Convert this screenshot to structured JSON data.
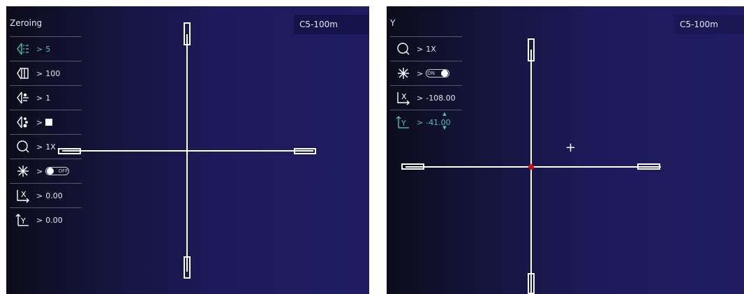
{
  "left": {
    "title": "Zeroing",
    "tag": "C5-100m",
    "menu": [
      {
        "icon": "zeroing-profile-icon",
        "arrow": ">",
        "value": "5"
      },
      {
        "icon": "zeroing-distance-icon",
        "arrow": ">",
        "value": "100"
      },
      {
        "icon": "reticle-type-icon",
        "arrow": ">",
        "value": "1"
      },
      {
        "icon": "reticle-color-icon",
        "arrow": ">",
        "value": ""
      },
      {
        "icon": "zoom-icon",
        "arrow": ">",
        "value": "1X"
      },
      {
        "icon": "freeze-icon",
        "arrow": ">",
        "value": "OFF"
      },
      {
        "icon": "x-axis-icon",
        "arrow": ">",
        "value": "0.00",
        "label": "X"
      },
      {
        "icon": "y-axis-icon",
        "arrow": ">",
        "value": "0.00",
        "label": "Y"
      }
    ]
  },
  "right": {
    "title": "Y",
    "tag": "C5-100m",
    "menu": [
      {
        "icon": "zoom-icon",
        "arrow": ">",
        "value": "1X"
      },
      {
        "icon": "freeze-icon",
        "arrow": ">",
        "value": "ON"
      },
      {
        "icon": "x-axis-icon",
        "arrow": ">",
        "value": "-108.00",
        "label": "X"
      },
      {
        "icon": "y-axis-icon",
        "arrow": ">",
        "value": "-41.00",
        "label": "Y"
      }
    ],
    "center_marker": "+"
  },
  "colors": {
    "accent": "#4fc3b0",
    "reticle": "#ffffff",
    "center_dot": "#cc1111",
    "background": "#1d1a5c"
  }
}
